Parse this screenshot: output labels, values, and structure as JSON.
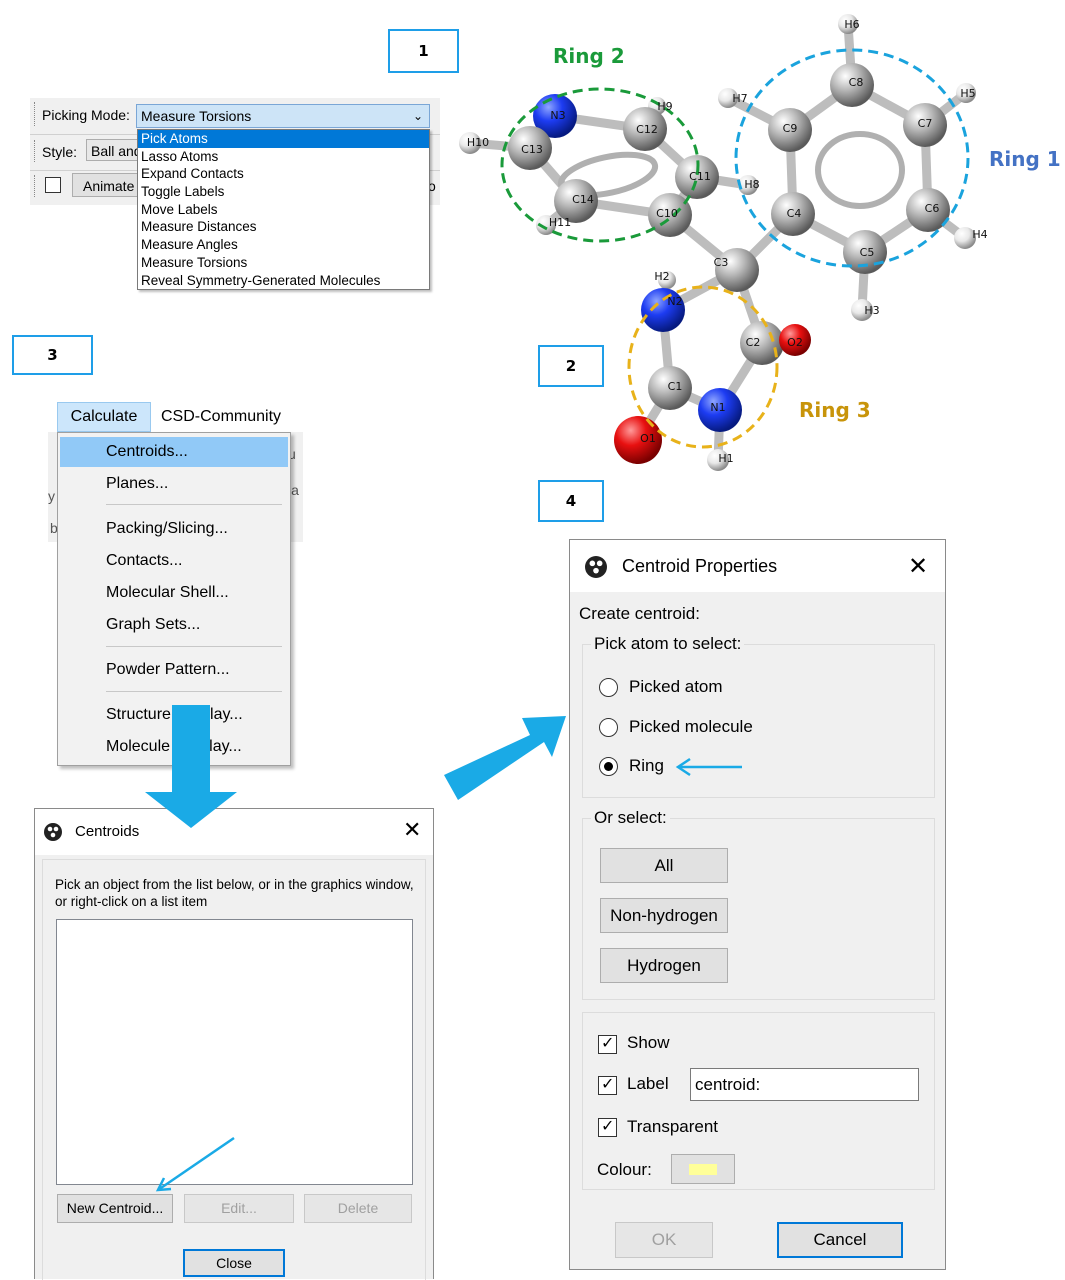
{
  "steps": [
    "1",
    "2",
    "3",
    "4"
  ],
  "panel1": {
    "picking_mode_label": "Picking Mode:",
    "picking_mode_value": "Measure Torsions",
    "style_label": "Style:",
    "style_value": "Ball and",
    "animate_label": "Animate",
    "clipped_o": "o",
    "options": [
      "Pick Atoms",
      "Lasso Atoms",
      "Expand Contacts",
      "Toggle Labels",
      "Move Labels",
      "Measure Distances",
      "Measure Angles",
      "Measure Torsions",
      "Reveal Symmetry-Generated Molecules"
    ],
    "selected_index": 0
  },
  "molecule": {
    "ring_labels": [
      "Ring 1",
      "Ring 2",
      "Ring 3"
    ],
    "ring_colors": {
      "ring1": "#1aa3dd",
      "ring2": "#1a9a3a",
      "ring3": "#e8b21a"
    },
    "atoms": [
      "H6",
      "C8",
      "H5",
      "H7",
      "C9",
      "C7",
      "H9",
      "N3",
      "C12",
      "H10",
      "C13",
      "C11",
      "H8",
      "C4",
      "C6",
      "C14",
      "C10",
      "H4",
      "H11",
      "C5",
      "C3",
      "H2",
      "N2",
      "H3",
      "C2",
      "O2",
      "C1",
      "N1",
      "O1",
      "H1"
    ]
  },
  "menubar": {
    "calculate": "Calculate",
    "csd_community": "CSD-Community"
  },
  "calculate_menu": {
    "items": [
      "Centroids...",
      "Planes...",
      "Packing/Slicing...",
      "Contacts...",
      "Molecular Shell...",
      "Graph Sets...",
      "Powder Pattern...",
      "Structure Overlay...",
      "Molecule Overlay..."
    ],
    "highlighted_index": 0,
    "clipped_chars": [
      "u",
      "la",
      "y",
      "b"
    ]
  },
  "centroids_dialog": {
    "title": "Centroids",
    "instructions": "Pick an object from the list below, or in the graphics window, or right-click on a list item",
    "new_button": "New Centroid...",
    "edit_button": "Edit...",
    "delete_button": "Delete",
    "close_button": "Close"
  },
  "centroid_props": {
    "title": "Centroid Properties",
    "create_label": "Create centroid:",
    "pick_group": "Pick atom to select:",
    "options": [
      "Picked atom",
      "Picked molecule",
      "Ring"
    ],
    "selected_option": 2,
    "or_select": "Or select:",
    "buttons": [
      "All",
      "Non-hydrogen",
      "Hydrogen"
    ],
    "show": {
      "label": "Show",
      "checked": true
    },
    "label_opt": {
      "label": "Label",
      "checked": true,
      "value": "centroid:"
    },
    "transparent": {
      "label": "Transparent",
      "checked": true
    },
    "colour_label": "Colour:",
    "colour_value": "#ffff99",
    "ok": "OK",
    "cancel": "Cancel"
  },
  "accent": "#1aaae6"
}
